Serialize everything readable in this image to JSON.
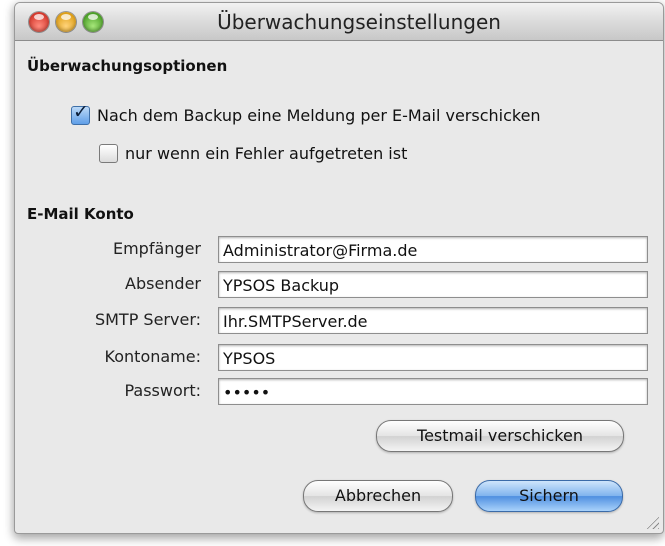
{
  "window": {
    "title": "Überwachungseinstellungen"
  },
  "monitoring": {
    "heading": "Überwachungsoptionen",
    "send_mail_label": "Nach dem Backup eine Meldung per E-Mail verschicken",
    "send_mail_checked": true,
    "only_error_label": "nur wenn ein Fehler aufgetreten ist",
    "only_error_checked": false
  },
  "account": {
    "heading": "E-Mail Konto",
    "fields": [
      {
        "label": "Empfänger",
        "value": "Administrator@Firma.de"
      },
      {
        "label": "Absender",
        "value": "YPSOS Backup"
      },
      {
        "label": "SMTP Server:",
        "value": "Ihr.SMTPServer.de"
      },
      {
        "label": "Kontoname:",
        "value": "YPSOS"
      },
      {
        "label": "Passwort:",
        "value": "•••••"
      }
    ]
  },
  "buttons": {
    "testmail": "Testmail verschicken",
    "cancel": "Abbrechen",
    "save": "Sichern"
  },
  "colors": {
    "default_button": "#5f9ee8",
    "window_bg": "#e9e9e9"
  }
}
